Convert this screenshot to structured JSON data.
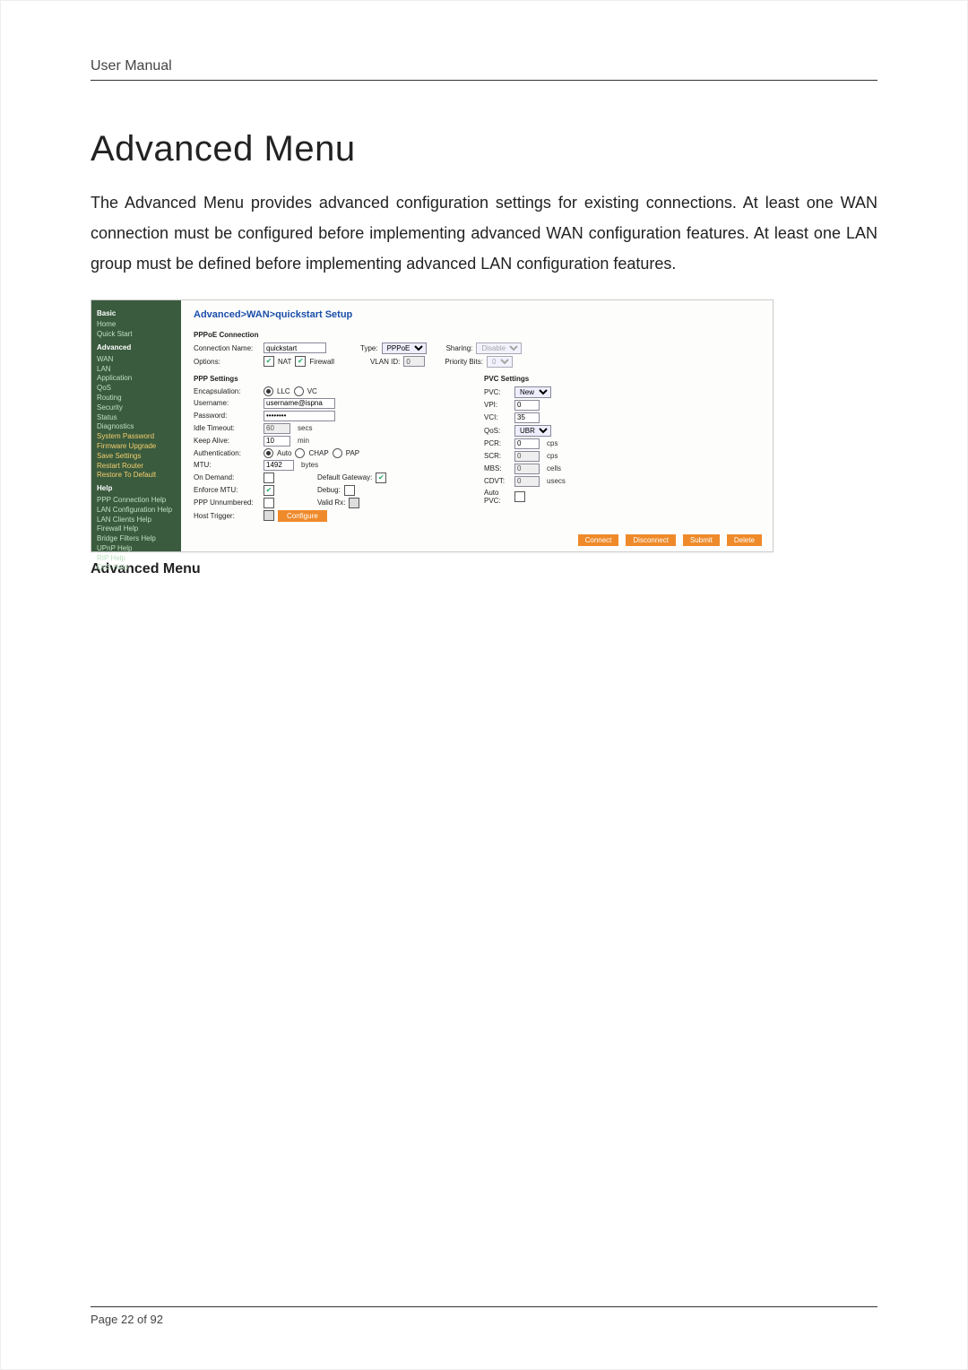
{
  "doc": {
    "header": "User Manual",
    "title": "Advanced Menu",
    "paragraph": "The Advanced Menu provides advanced configuration settings for existing connections. At least one WAN connection must be configured before implementing advanced WAN configuration features. At least one LAN group must be defined before implementing advanced LAN configuration features.",
    "caption": "Advanced Menu",
    "page_label": "Page 22 of 92"
  },
  "sidebar": {
    "basic": {
      "title": "Basic",
      "items": [
        "Home",
        "Quick Start"
      ]
    },
    "advanced": {
      "title": "Advanced",
      "items": [
        "WAN",
        "LAN",
        "Application",
        "QoS",
        "Routing",
        "Security",
        "Status",
        "Diagnostics",
        "System Password",
        "Firmware Upgrade",
        "Save Settings",
        "Restart Router",
        "Restore To Default"
      ]
    },
    "help": {
      "title": "Help",
      "items": [
        "PPP Connection Help",
        "LAN Configuration Help",
        "LAN Clients Help",
        "Firewall Help",
        "Bridge Filters Help",
        "UPnP Help",
        "RIP Help",
        "QoS Help"
      ]
    }
  },
  "breadcrumb": "Advanced>WAN>quickstart Setup",
  "pppoe": {
    "section": "PPPoE Connection",
    "name_label": "Connection Name:",
    "name_value": "quickstart",
    "type_label": "Type:",
    "type_value": "PPPoE",
    "sharing_label": "Sharing:",
    "sharing_value": "Disable",
    "options_label": "Options:",
    "nat_label": "NAT",
    "firewall_label": "Firewall",
    "vlan_label": "VLAN ID:",
    "vlan_value": "0",
    "prio_label": "Priority Bits:",
    "prio_value": "0"
  },
  "ppp": {
    "section": "PPP Settings",
    "encap_label": "Encapsulation:",
    "encap_llc": "LLC",
    "encap_vc": "VC",
    "user_label": "Username:",
    "user_value": "username@ispna",
    "pass_label": "Password:",
    "pass_value": "••••••••",
    "idle_label": "Idle Timeout:",
    "idle_value": "60",
    "idle_unit": "secs",
    "keep_label": "Keep Alive:",
    "keep_value": "10",
    "keep_unit": "min",
    "auth_label": "Authentication:",
    "auth_auto": "Auto",
    "auth_chap": "CHAP",
    "auth_pap": "PAP",
    "mtu_label": "MTU:",
    "mtu_value": "1492",
    "mtu_unit": "bytes",
    "od_label": "On Demand:",
    "dg_label": "Default Gateway:",
    "emtu_label": "Enforce MTU:",
    "debug_label": "Debug:",
    "pppun_label": "PPP Unnumbered:",
    "validrx_label": "Valid Rx:",
    "host_label": "Host Trigger:",
    "configure": "Configure"
  },
  "pvc": {
    "section": "PVC Settings",
    "pvc_label": "PVC:",
    "pvc_value": "New",
    "vpi_label": "VPI:",
    "vpi_value": "0",
    "vci_label": "VCI:",
    "vci_value": "35",
    "qos_label": "QoS:",
    "qos_value": "UBR",
    "pcr_label": "PCR:",
    "pcr_value": "0",
    "pcr_unit": "cps",
    "scr_label": "SCR:",
    "scr_value": "0",
    "scr_unit": "cps",
    "mbs_label": "MBS:",
    "mbs_value": "0",
    "mbs_unit": "cells",
    "cdvt_label": "CDVT:",
    "cdvt_value": "0",
    "cdvt_unit": "usecs",
    "auto_label": "Auto PVC:"
  },
  "buttons": {
    "connect": "Connect",
    "disconnect": "Disconnect",
    "submit": "Submit",
    "delete": "Delete"
  }
}
